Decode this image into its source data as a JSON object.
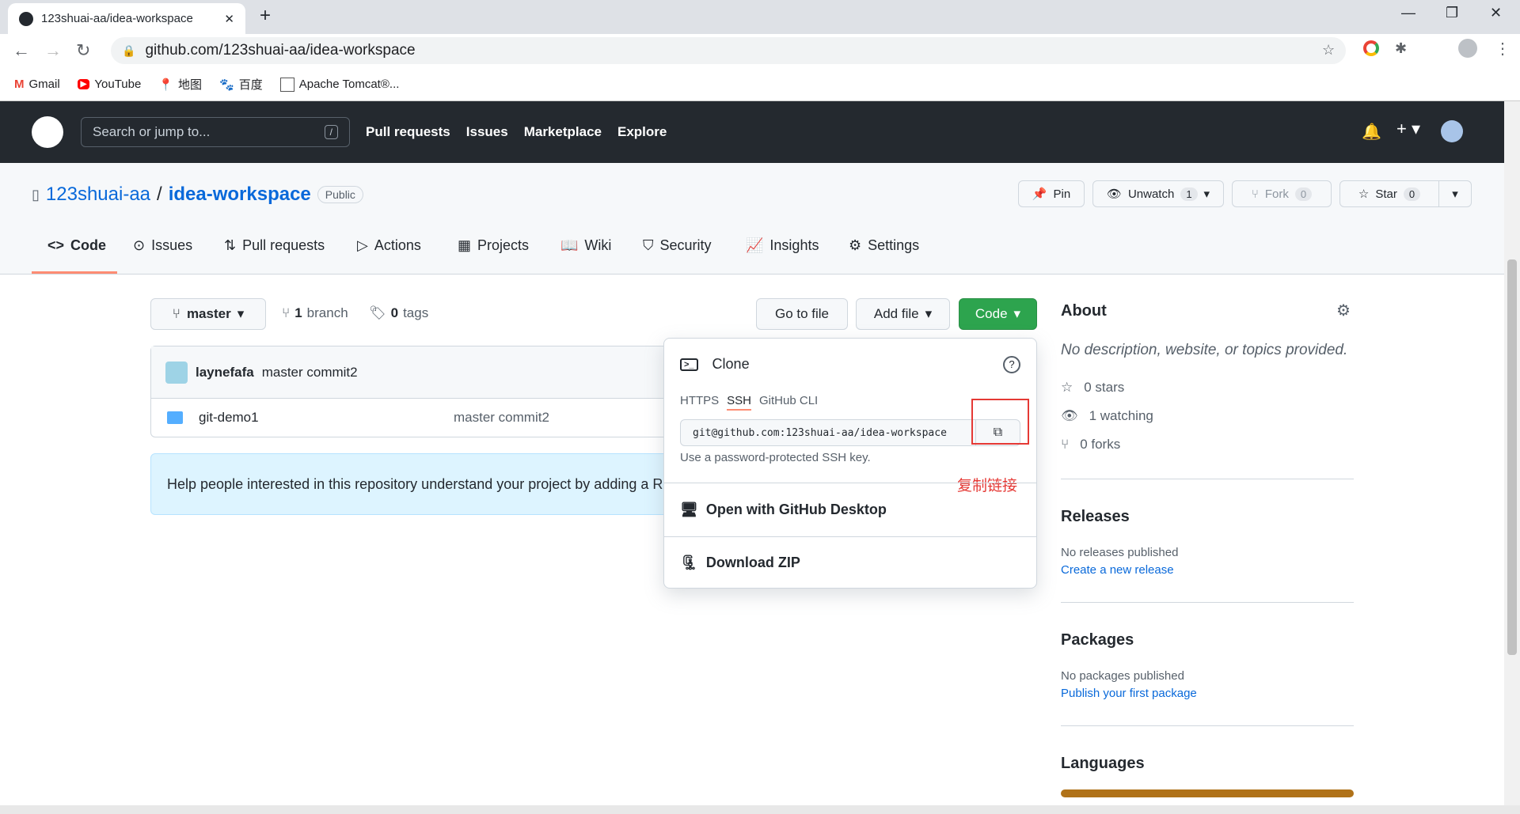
{
  "browser": {
    "tab_title": "123shuai-aa/idea-workspace",
    "url": "github.com/123shuai-aa/idea-workspace",
    "bookmarks": [
      "Gmail",
      "YouTube",
      "地图",
      "百度",
      "Apache Tomcat®..."
    ]
  },
  "header": {
    "search_placeholder": "Search or jump to...",
    "search_key": "/",
    "nav": [
      "Pull requests",
      "Issues",
      "Marketplace",
      "Explore"
    ]
  },
  "repo": {
    "owner": "123shuai-aa",
    "sep": "/",
    "name": "idea-workspace",
    "visibility": "Public",
    "pin": "Pin",
    "unwatch": "Unwatch",
    "watch_count": "1",
    "fork": "Fork",
    "fork_count": "0",
    "star": "Star",
    "star_count": "0",
    "tabs": [
      "Code",
      "Issues",
      "Pull requests",
      "Actions",
      "Projects",
      "Wiki",
      "Security",
      "Insights",
      "Settings"
    ]
  },
  "main": {
    "branch": "master",
    "branches_n": "1",
    "branches_l": "branch",
    "tags_n": "0",
    "tags_l": "tags",
    "go_to_file": "Go to file",
    "add_file": "Add file",
    "code": "Code",
    "commit_author": "laynefafa",
    "commit_msg": "master commit2",
    "files": [
      {
        "name": "git-demo1",
        "commit": "master commit2"
      }
    ],
    "readme_hint": "Help people interested in this repository understand your project by adding a REA"
  },
  "clone": {
    "title": "Clone",
    "tabs": [
      "HTTPS",
      "SSH",
      "GitHub CLI"
    ],
    "active_tab": "SSH",
    "url": "git@github.com:123shuai-aa/idea-workspace",
    "hint": "Use a password-protected SSH key.",
    "annotation": "复制链接",
    "desktop": "Open with GitHub Desktop",
    "zip": "Download ZIP"
  },
  "about": {
    "title": "About",
    "desc": "No description, website, or topics provided.",
    "stars": "0 stars",
    "watching": "1 watching",
    "forks": "0 forks",
    "releases_title": "Releases",
    "releases_none": "No releases published",
    "releases_link": "Create a new release",
    "packages_title": "Packages",
    "packages_none": "No packages published",
    "packages_link": "Publish your first package",
    "languages_title": "Languages",
    "language_color": "#b07219"
  }
}
